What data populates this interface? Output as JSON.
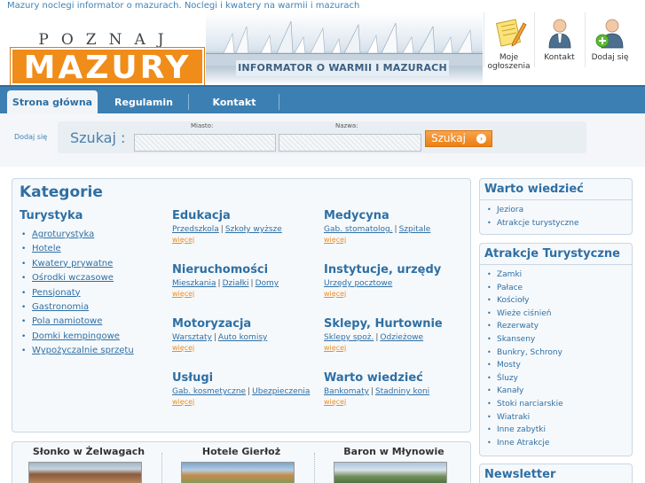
{
  "top_strip": {
    "text": "Mazury noclegi informator o mazurach. Noclegi i kwatery na warmii i mazurach"
  },
  "header": {
    "logo_top": "POZNAJ",
    "logo_main": "MAZURY",
    "tagline": "INFORMATOR O WARMII I MAZURACH",
    "icons": [
      {
        "label1": "Moje",
        "label2": "ogłoszenia",
        "icon": "notepad-pencil-icon"
      },
      {
        "label1": "Kontakt",
        "label2": "",
        "icon": "person-contact-icon"
      },
      {
        "label1": "Dodaj się",
        "label2": "",
        "icon": "person-add-icon"
      }
    ]
  },
  "nav": {
    "tabs": [
      {
        "label": "Strona główna",
        "active": true
      },
      {
        "label": "Regulamin",
        "active": false
      },
      {
        "label": "Kontakt",
        "active": false
      }
    ]
  },
  "search": {
    "add_link": "Dodaj się",
    "label": "Szukaj :",
    "city_label": "Miasto:",
    "name_label": "Nazwa:",
    "button": "Szukaj"
  },
  "categories": {
    "title": "Kategorie",
    "turystyka": {
      "heading": "Turystyka",
      "items": [
        "Agroturystyka",
        "Hotele",
        "Kwatery prywatne",
        "Ośrodki wczasowe",
        "Pensjonaty",
        "Gastronomia",
        "Pola namiotowe",
        "Domki kempingowe",
        "Wypożyczalnie sprzętu"
      ]
    },
    "blocks": [
      {
        "heading": "Edukacja",
        "links": [
          "Przedszkola",
          "Szkoły wyższe"
        ],
        "more": "więcej"
      },
      {
        "heading": "Medycyna",
        "links": [
          "Gab. stomatolog.",
          "Szpitale"
        ],
        "more": "więcej"
      },
      {
        "heading": "Nieruchomości",
        "links": [
          "Mieszkania",
          "Działki",
          "Domy"
        ],
        "more": "więcej"
      },
      {
        "heading": "Instytucje, urzędy",
        "links": [
          "Urzędy pocztowe"
        ],
        "more": "więcej"
      },
      {
        "heading": "Motoryzacja",
        "links": [
          "Warsztaty",
          "Auto komisy"
        ],
        "more": "więcej"
      },
      {
        "heading": "Sklepy, Hurtownie",
        "links": [
          "Sklepy spoż.",
          "Odzieżowe"
        ],
        "more": "więcej"
      },
      {
        "heading": "Usługi",
        "links": [
          "Gab. kosmetyczne",
          "Ubezpieczenia"
        ],
        "more": "więcej"
      },
      {
        "heading": "Warto wiedzieć",
        "links": [
          "Bankomaty",
          "Stadniny koni"
        ],
        "more": "więcej"
      }
    ]
  },
  "promo": {
    "items": [
      "Słonko w Żelwagach",
      "Hotele Gierłoż",
      "Baron w Młynowie"
    ]
  },
  "sidebar": {
    "warto": {
      "heading": "Warto wiedzieć",
      "items": [
        "Jeziora",
        "Atrakcje turystyczne"
      ]
    },
    "atrakcje": {
      "heading": "Atrakcje Turystyczne",
      "items": [
        "Zamki",
        "Pałace",
        "Kościoły",
        "Wieże ciśnień",
        "Rezerwaty",
        "Skanseny",
        "Bunkry, Schrony",
        "Mosty",
        "Śluzy",
        "Kanały",
        "Stoki narciarskie",
        "Wiatraki",
        "Inne zabytki",
        "Inne Atrakcje"
      ]
    },
    "newsletter": {
      "heading": "Newsletter"
    }
  }
}
